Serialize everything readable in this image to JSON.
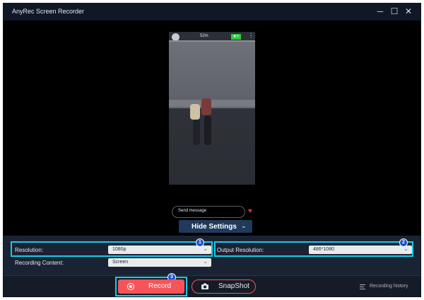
{
  "window": {
    "title": "AnyRec Screen Recorder"
  },
  "controls": {
    "minimize": "─",
    "maximize": "☐",
    "close": "✕"
  },
  "preview": {
    "story_time": "52m",
    "live_badge": "★+",
    "message_placeholder": "Send message",
    "heart": "♥",
    "nav_back": "◁",
    "nav_home": "○",
    "nav_recent": "□"
  },
  "hide_settings": {
    "label": "Hide Settings"
  },
  "settings": {
    "resolution_label": "Resolution:",
    "resolution_value": "1080p",
    "output_resolution_label": "Output Resolution:",
    "output_resolution_value": "486*1080",
    "recording_content_label": "Recording Content:",
    "recording_content_value": "Screen"
  },
  "badges": [
    "1",
    "2",
    "3"
  ],
  "actions": {
    "record_label": "Record",
    "snapshot_label": "SnapShot",
    "history_label": "Recording history"
  },
  "colors": {
    "accent_red": "#f6545a",
    "highlight_cyan": "#19c9e6",
    "badge_blue": "#1e4fd6",
    "window_bg": "#151c28"
  },
  "icons": {
    "record": "record-icon",
    "camera": "camera-icon",
    "history": "list-icon",
    "chevron": "chevron-down-icon"
  }
}
